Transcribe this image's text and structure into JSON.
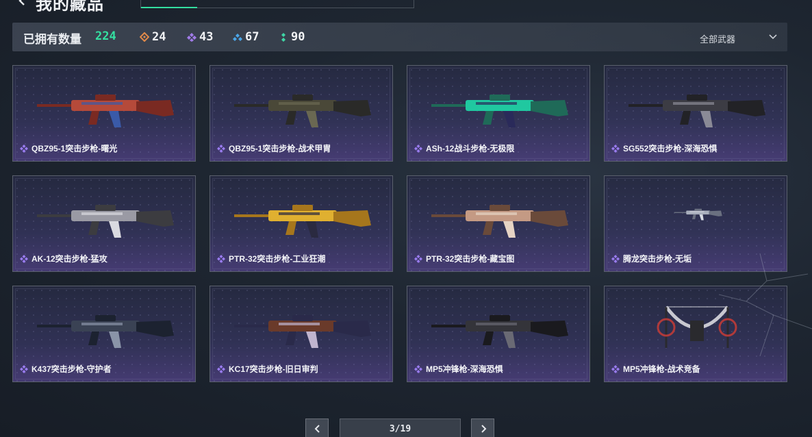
{
  "header": {
    "title": "我的藏品"
  },
  "stats": {
    "own_label": "已拥有数量",
    "own_count": "224",
    "rarities": [
      {
        "icon": "orange-diamond-icon",
        "color": "#e08a4a",
        "count": "24"
      },
      {
        "icon": "purple-diamond-icon",
        "color": "#a07be8",
        "count": "43"
      },
      {
        "icon": "blue-diamond-icon",
        "color": "#4aa6e8",
        "count": "67"
      },
      {
        "icon": "green-dots-icon",
        "color": "#3fd6a6",
        "count": "90"
      }
    ]
  },
  "filter": {
    "selected": "全部武器"
  },
  "accent_color": "#34e0a1",
  "items": [
    {
      "name": "QBZ95-1突击步枪-曙光",
      "rarity_color": "#9a7cf0",
      "palette": [
        "#7a2a22",
        "#b54a3a",
        "#3a5aa8"
      ]
    },
    {
      "name": "QBZ95-1突击步枪-战术甲胄",
      "rarity_color": "#9a7cf0",
      "palette": [
        "#2a2a28",
        "#4a4838",
        "#6a6852"
      ]
    },
    {
      "name": "ASh-12战斗步枪-无极限",
      "rarity_color": "#9a7cf0",
      "palette": [
        "#1f6a58",
        "#20c8a0",
        "#2a2a5a"
      ]
    },
    {
      "name": "SG552突击步枪-深海恐惧",
      "rarity_color": "#9a7cf0",
      "palette": [
        "#222226",
        "#3c3c44",
        "#8a8a96"
      ]
    },
    {
      "name": "AK-12突击步枪-猛攻",
      "rarity_color": "#9a7cf0",
      "palette": [
        "#3c3c40",
        "#9a9aa4",
        "#dadae0"
      ]
    },
    {
      "name": "PTR-32突击步枪-工业狂潮",
      "rarity_color": "#9a7cf0",
      "palette": [
        "#a6761c",
        "#e0b030",
        "#2a2a40"
      ]
    },
    {
      "name": "PTR-32突击步枪-藏宝图",
      "rarity_color": "#9a7cf0",
      "palette": [
        "#6a4a3a",
        "#c49a84",
        "#e6d4c4"
      ]
    },
    {
      "name": "腾龙突击步枪-无垢",
      "rarity_color": "#9a7cf0",
      "palette": [
        "#6a7080",
        "#a8aebc",
        "#d8dce4"
      ]
    },
    {
      "name": "K437突击步枪-守护者",
      "rarity_color": "#9a7cf0",
      "palette": [
        "#1c2230",
        "#3a4254",
        "#8a94a8"
      ]
    },
    {
      "name": "KC17突击步枪-旧日审判",
      "rarity_color": "#9a7cf0",
      "palette": [
        "#2a2a4a",
        "#6a3a2a",
        "#c0b4ce"
      ]
    },
    {
      "name": "MP5冲锋枪-深海恐惧",
      "rarity_color": "#9a7cf0",
      "palette": [
        "#1a1a1e",
        "#34343a",
        "#6a6a74"
      ]
    },
    {
      "name": "MP5冲锋枪-战术竞备",
      "rarity_color": "#9a7cf0",
      "palette": [
        "#2a2a2e",
        "#c8c8d0",
        "#b03a3a"
      ]
    }
  ],
  "pagination": {
    "label": "3/19"
  }
}
